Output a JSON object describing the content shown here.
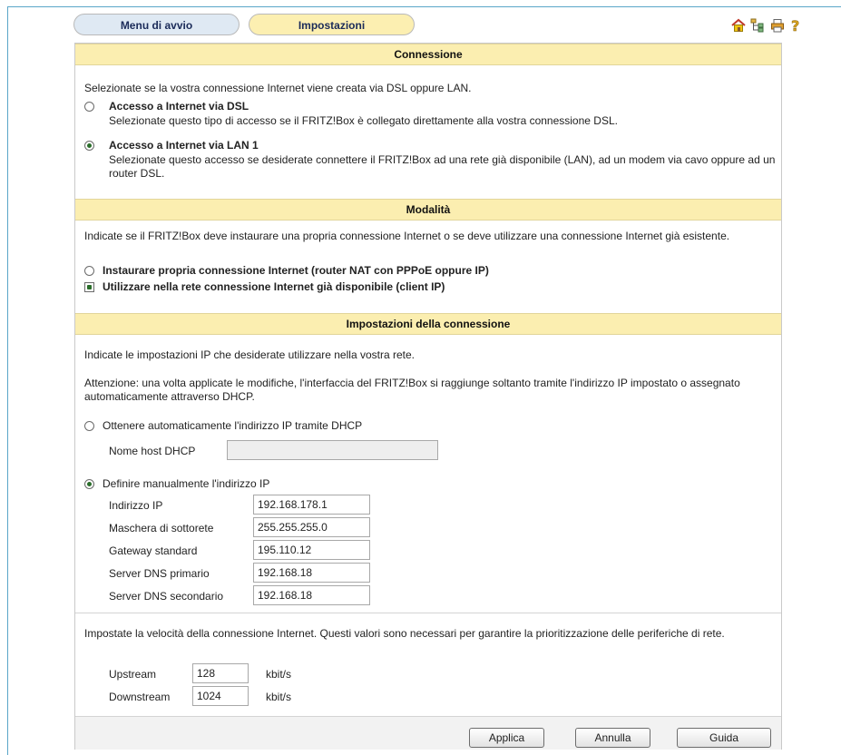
{
  "tabs": {
    "start": "Menu di avvio",
    "settings": "Impostazioni"
  },
  "toolbar_icons": [
    "home-icon",
    "sitemap-icon",
    "print-icon",
    "help-icon"
  ],
  "connection": {
    "header": "Connessione",
    "intro": "Selezionate se la vostra connessione Internet viene creata via DSL oppure LAN.",
    "option_dsl": {
      "title": "Accesso a Internet via DSL",
      "desc": "Selezionate questo tipo di accesso se il FRITZ!Box è collegato direttamente alla vostra connessione DSL.",
      "selected": false
    },
    "option_lan": {
      "title": "Accesso a Internet via LAN 1",
      "desc": "Selezionate questo accesso se desiderate connettere il FRITZ!Box ad una rete già disponibile (LAN), ad un modem via cavo oppure ad un router DSL.",
      "selected": true
    }
  },
  "mode": {
    "header": "Modalità",
    "intro": "Indicate se il FRITZ!Box deve instaurare una propria connessione Internet o se deve utilizzare una connessione Internet già esistente.",
    "option_router": {
      "label": "Instaurare propria connessione Internet (router NAT con PPPoE oppure IP)",
      "selected": false
    },
    "option_client": {
      "label": "Utilizzare nella rete connessione Internet già disponibile (client IP)",
      "selected": true
    }
  },
  "conn_settings": {
    "header": "Impostazioni della connessione",
    "intro": "Indicate le impostazioni IP che desiderate utilizzare nella vostra rete.",
    "warning": "Attenzione: una volta applicate le modifiche, l'interfaccia del FRITZ!Box si raggiunge soltanto tramite l'indirizzo IP impostato o assegnato automaticamente attraverso DHCP.",
    "dhcp_option": "Ottenere automaticamente l'indirizzo IP tramite DHCP",
    "dhcp_selected": false,
    "dhcp_host_label": "Nome host DHCP",
    "dhcp_host_value": "",
    "manual_option": "Definire manualmente l'indirizzo IP",
    "manual_selected": true,
    "fields": [
      {
        "label": "Indirizzo IP",
        "value": "192.168.178.1"
      },
      {
        "label": "Maschera di sottorete",
        "value": "255.255.255.0"
      },
      {
        "label": "Gateway standard",
        "value": "195.110.12"
      },
      {
        "label": "Server DNS primario",
        "value": "192.168.18"
      },
      {
        "label": "Server DNS secondario",
        "value": "192.168.18"
      }
    ]
  },
  "speed": {
    "intro": "Impostate la velocità della connessione Internet. Questi valori sono necessari per garantire la prioritizzazione delle periferiche di rete.",
    "upstream_label": "Upstream",
    "upstream_value": "128",
    "downstream_label": "Downstream",
    "downstream_value": "1024",
    "unit": "kbit/s"
  },
  "buttons": {
    "apply": "Applica",
    "cancel": "Annulla",
    "help": "Guida"
  },
  "colors": {
    "band": "#fbeeb0",
    "tab_start": "#dfe9f3",
    "tab_settings": "#fcefb1",
    "frame": "#5aa6c8"
  }
}
